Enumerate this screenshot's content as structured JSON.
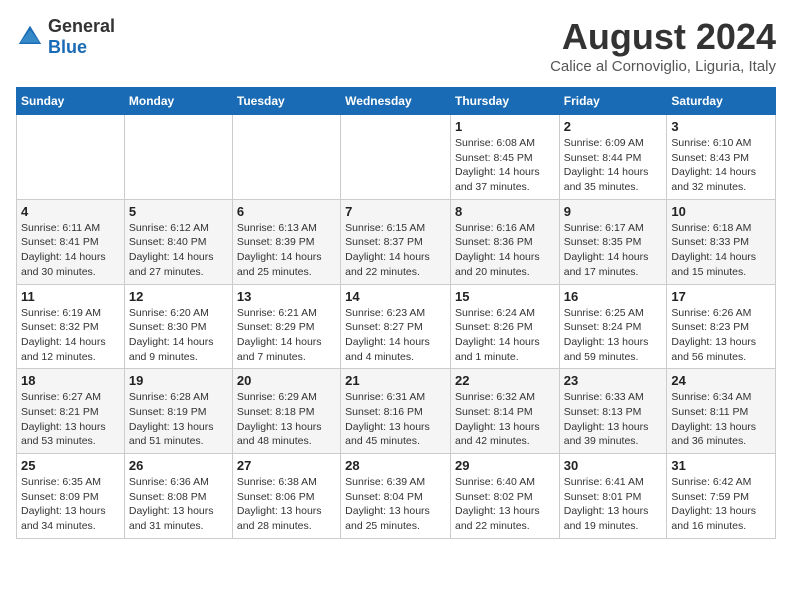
{
  "logo": {
    "general": "General",
    "blue": "Blue"
  },
  "title": "August 2024",
  "location": "Calice al Cornoviglio, Liguria, Italy",
  "headers": [
    "Sunday",
    "Monday",
    "Tuesday",
    "Wednesday",
    "Thursday",
    "Friday",
    "Saturday"
  ],
  "weeks": [
    [
      {
        "day": "",
        "detail": ""
      },
      {
        "day": "",
        "detail": ""
      },
      {
        "day": "",
        "detail": ""
      },
      {
        "day": "",
        "detail": ""
      },
      {
        "day": "1",
        "detail": "Sunrise: 6:08 AM\nSunset: 8:45 PM\nDaylight: 14 hours and 37 minutes."
      },
      {
        "day": "2",
        "detail": "Sunrise: 6:09 AM\nSunset: 8:44 PM\nDaylight: 14 hours and 35 minutes."
      },
      {
        "day": "3",
        "detail": "Sunrise: 6:10 AM\nSunset: 8:43 PM\nDaylight: 14 hours and 32 minutes."
      }
    ],
    [
      {
        "day": "4",
        "detail": "Sunrise: 6:11 AM\nSunset: 8:41 PM\nDaylight: 14 hours and 30 minutes."
      },
      {
        "day": "5",
        "detail": "Sunrise: 6:12 AM\nSunset: 8:40 PM\nDaylight: 14 hours and 27 minutes."
      },
      {
        "day": "6",
        "detail": "Sunrise: 6:13 AM\nSunset: 8:39 PM\nDaylight: 14 hours and 25 minutes."
      },
      {
        "day": "7",
        "detail": "Sunrise: 6:15 AM\nSunset: 8:37 PM\nDaylight: 14 hours and 22 minutes."
      },
      {
        "day": "8",
        "detail": "Sunrise: 6:16 AM\nSunset: 8:36 PM\nDaylight: 14 hours and 20 minutes."
      },
      {
        "day": "9",
        "detail": "Sunrise: 6:17 AM\nSunset: 8:35 PM\nDaylight: 14 hours and 17 minutes."
      },
      {
        "day": "10",
        "detail": "Sunrise: 6:18 AM\nSunset: 8:33 PM\nDaylight: 14 hours and 15 minutes."
      }
    ],
    [
      {
        "day": "11",
        "detail": "Sunrise: 6:19 AM\nSunset: 8:32 PM\nDaylight: 14 hours and 12 minutes."
      },
      {
        "day": "12",
        "detail": "Sunrise: 6:20 AM\nSunset: 8:30 PM\nDaylight: 14 hours and 9 minutes."
      },
      {
        "day": "13",
        "detail": "Sunrise: 6:21 AM\nSunset: 8:29 PM\nDaylight: 14 hours and 7 minutes."
      },
      {
        "day": "14",
        "detail": "Sunrise: 6:23 AM\nSunset: 8:27 PM\nDaylight: 14 hours and 4 minutes."
      },
      {
        "day": "15",
        "detail": "Sunrise: 6:24 AM\nSunset: 8:26 PM\nDaylight: 14 hours and 1 minute."
      },
      {
        "day": "16",
        "detail": "Sunrise: 6:25 AM\nSunset: 8:24 PM\nDaylight: 13 hours and 59 minutes."
      },
      {
        "day": "17",
        "detail": "Sunrise: 6:26 AM\nSunset: 8:23 PM\nDaylight: 13 hours and 56 minutes."
      }
    ],
    [
      {
        "day": "18",
        "detail": "Sunrise: 6:27 AM\nSunset: 8:21 PM\nDaylight: 13 hours and 53 minutes."
      },
      {
        "day": "19",
        "detail": "Sunrise: 6:28 AM\nSunset: 8:19 PM\nDaylight: 13 hours and 51 minutes."
      },
      {
        "day": "20",
        "detail": "Sunrise: 6:29 AM\nSunset: 8:18 PM\nDaylight: 13 hours and 48 minutes."
      },
      {
        "day": "21",
        "detail": "Sunrise: 6:31 AM\nSunset: 8:16 PM\nDaylight: 13 hours and 45 minutes."
      },
      {
        "day": "22",
        "detail": "Sunrise: 6:32 AM\nSunset: 8:14 PM\nDaylight: 13 hours and 42 minutes."
      },
      {
        "day": "23",
        "detail": "Sunrise: 6:33 AM\nSunset: 8:13 PM\nDaylight: 13 hours and 39 minutes."
      },
      {
        "day": "24",
        "detail": "Sunrise: 6:34 AM\nSunset: 8:11 PM\nDaylight: 13 hours and 36 minutes."
      }
    ],
    [
      {
        "day": "25",
        "detail": "Sunrise: 6:35 AM\nSunset: 8:09 PM\nDaylight: 13 hours and 34 minutes."
      },
      {
        "day": "26",
        "detail": "Sunrise: 6:36 AM\nSunset: 8:08 PM\nDaylight: 13 hours and 31 minutes."
      },
      {
        "day": "27",
        "detail": "Sunrise: 6:38 AM\nSunset: 8:06 PM\nDaylight: 13 hours and 28 minutes."
      },
      {
        "day": "28",
        "detail": "Sunrise: 6:39 AM\nSunset: 8:04 PM\nDaylight: 13 hours and 25 minutes."
      },
      {
        "day": "29",
        "detail": "Sunrise: 6:40 AM\nSunset: 8:02 PM\nDaylight: 13 hours and 22 minutes."
      },
      {
        "day": "30",
        "detail": "Sunrise: 6:41 AM\nSunset: 8:01 PM\nDaylight: 13 hours and 19 minutes."
      },
      {
        "day": "31",
        "detail": "Sunrise: 6:42 AM\nSunset: 7:59 PM\nDaylight: 13 hours and 16 minutes."
      }
    ]
  ]
}
